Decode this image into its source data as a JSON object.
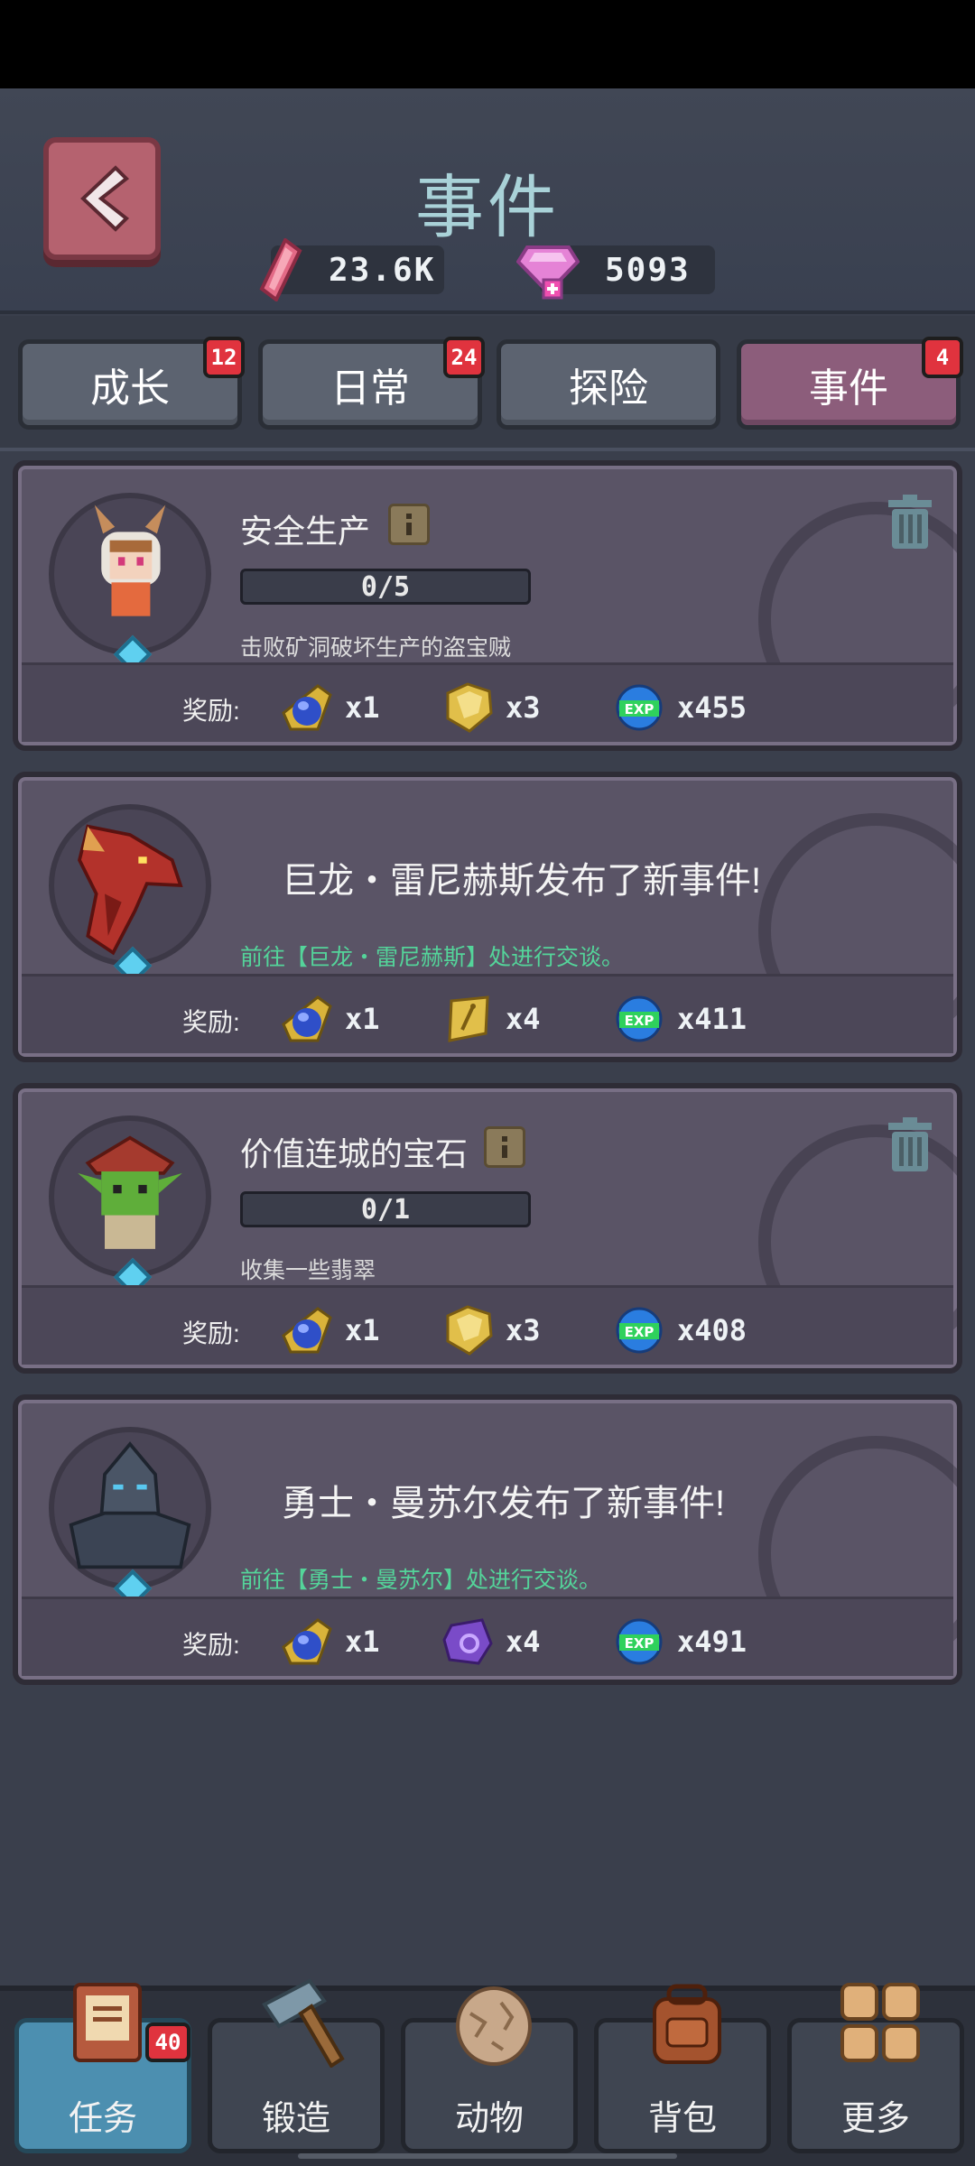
{
  "header": {
    "title": "事件",
    "currency_red": "23.6K",
    "currency_pink": "5093"
  },
  "tabs": [
    {
      "label": "成长",
      "badge": "12",
      "active": false
    },
    {
      "label": "日常",
      "badge": "24",
      "active": false
    },
    {
      "label": "探险",
      "badge": "",
      "active": false
    },
    {
      "label": "事件",
      "badge": "4",
      "active": true
    }
  ],
  "events": [
    {
      "title": "安全生产",
      "progress": "0/5",
      "description": "击败矿洞破坏生产的盗宝贼",
      "reward_label": "奖励:",
      "rewards": [
        {
          "icon": "sapphire-icon",
          "count": "x1"
        },
        {
          "icon": "gold-ore-icon",
          "count": "x3"
        },
        {
          "icon": "exp-icon",
          "count": "x455"
        }
      ]
    },
    {
      "message": "巨龙・雷尼赫斯发布了新事件!",
      "link": "前往【巨龙・雷尼赫斯】处进行交谈。",
      "reward_label": "奖励:",
      "rewards": [
        {
          "icon": "sapphire-icon",
          "count": "x1"
        },
        {
          "icon": "gold-scroll-icon",
          "count": "x4"
        },
        {
          "icon": "exp-icon",
          "count": "x411"
        }
      ]
    },
    {
      "title": "价值连城的宝石",
      "progress": "0/1",
      "description": "收集一些翡翠",
      "reward_label": "奖励:",
      "rewards": [
        {
          "icon": "sapphire-icon",
          "count": "x1"
        },
        {
          "icon": "gold-ore-icon",
          "count": "x3"
        },
        {
          "icon": "exp-icon",
          "count": "x408"
        }
      ]
    },
    {
      "message": "勇士・曼苏尔发布了新事件!",
      "link": "前往【勇士・曼苏尔】处进行交谈。",
      "reward_label": "奖励:",
      "rewards": [
        {
          "icon": "sapphire-icon",
          "count": "x1"
        },
        {
          "icon": "purple-rune-icon",
          "count": "x4"
        },
        {
          "icon": "exp-icon",
          "count": "x491"
        }
      ]
    }
  ],
  "bottom_nav": [
    {
      "label": "任务",
      "badge": "40",
      "icon": "quest-book-icon",
      "active": true
    },
    {
      "label": "锻造",
      "badge": "",
      "icon": "hammer-icon",
      "active": false
    },
    {
      "label": "动物",
      "badge": "",
      "icon": "egg-icon",
      "active": false
    },
    {
      "label": "背包",
      "badge": "",
      "icon": "backpack-icon",
      "active": false
    },
    {
      "label": "更多",
      "badge": "",
      "icon": "grid-icon",
      "active": false
    }
  ],
  "exp_icon_text": "EXP"
}
